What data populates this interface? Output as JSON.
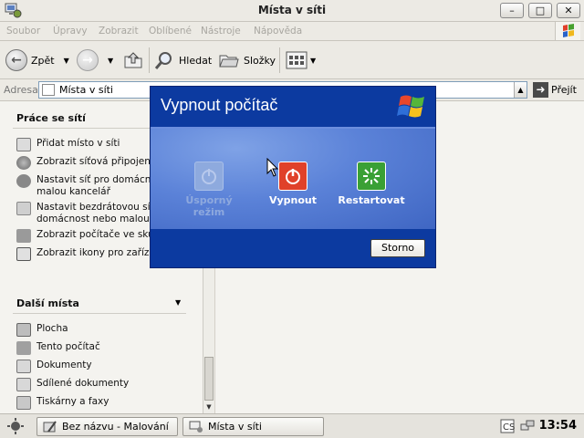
{
  "window": {
    "title": "Místa v síti",
    "minimize_label": "–",
    "maximize_label": "□",
    "close_label": "✕"
  },
  "menu": {
    "items": [
      "Soubor",
      "Úpravy",
      "Zobrazit",
      "Oblíbené",
      "Nástroje",
      "Nápověda"
    ]
  },
  "toolbar": {
    "back_label": "Zpět",
    "search_label": "Hledat",
    "folders_label": "Složky"
  },
  "address": {
    "label": "Adresa",
    "value": "Místa v síti",
    "go_label": "Přejít"
  },
  "left_panel": {
    "network_tasks": {
      "title": "Práce se sítí",
      "items": [
        "Přidat místo v síti",
        "Zobrazit síťová připojení",
        "Nastavit síť pro domácnost nebo malou kancelář",
        "Nastavit bezdrátovou síť pro domácnost nebo malou ka",
        "Zobrazit počítače ve skup",
        "Zobrazit ikony pro zařízen v síti"
      ]
    },
    "other_places": {
      "title": "Další místa",
      "items": [
        "Plocha",
        "Tento počítač",
        "Dokumenty",
        "Sdílené dokumenty",
        "Tiskárny a faxy"
      ]
    }
  },
  "dialog": {
    "title": "Vypnout počítač",
    "options": {
      "standby": "Úsporný režim",
      "shutdown": "Vypnout",
      "restart": "Restartovat"
    },
    "cancel_label": "Storno",
    "colors": {
      "header": "#0c3aa0",
      "shutdown_red": "#e0412a",
      "restart_green": "#3aa035"
    }
  },
  "taskbar": {
    "tasks": [
      "Bez názvu - Malování",
      "Místa v síti"
    ],
    "clock": "13:54"
  }
}
